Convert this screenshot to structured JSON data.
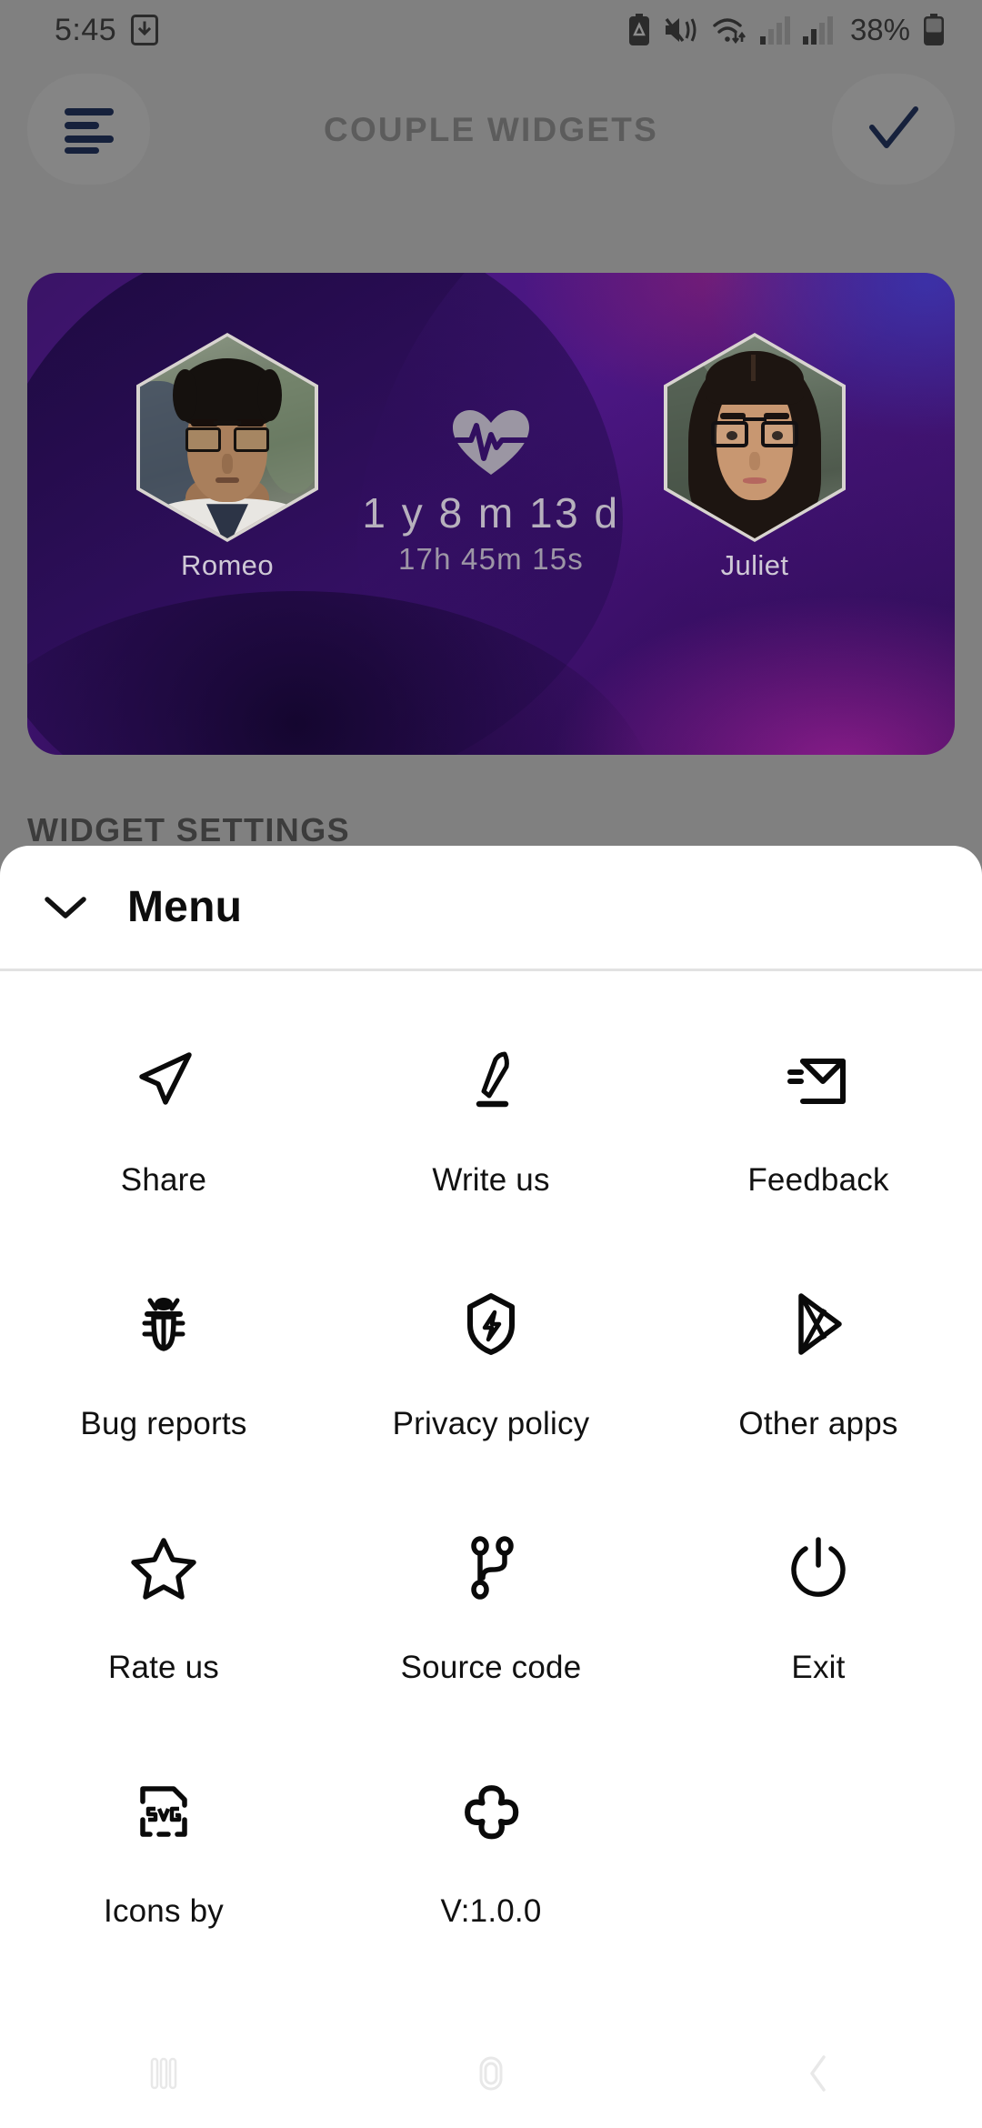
{
  "status_bar": {
    "clock": "5:45",
    "battery_percent": "38%",
    "icons": [
      "download-icon",
      "battery-saver-icon",
      "mute-vibrate-icon",
      "wifi-icon",
      "signal-sim1-icon",
      "signal-sim2-icon",
      "battery-icon"
    ]
  },
  "app_bar": {
    "title": "COUPLE WIDGETS",
    "menu_icon": "hamburger-icon",
    "confirm_icon": "check-icon"
  },
  "widget_card": {
    "left_person": {
      "name": "Romeo"
    },
    "right_person": {
      "name": "Juliet"
    },
    "center_icon": "heart-pulse-icon",
    "duration_main": "1 y 8 m 13 d",
    "duration_sub": "17h 45m 15s",
    "colors": {
      "purple_dark": "#2a0b4e",
      "purple_mid": "#4a1580",
      "magenta": "#d62ab4",
      "blue": "#2c38aa"
    }
  },
  "section_heading": "WIDGET SETTINGS",
  "menu_sheet": {
    "title": "Menu",
    "collapse_icon": "chevron-down-icon",
    "items": [
      {
        "label": "Share",
        "icon": "send-icon"
      },
      {
        "label": "Write us",
        "icon": "pencil-icon"
      },
      {
        "label": "Feedback",
        "icon": "mail-send-icon"
      },
      {
        "label": "Bug reports",
        "icon": "bug-icon"
      },
      {
        "label": "Privacy policy",
        "icon": "shield-bolt-icon"
      },
      {
        "label": "Other apps",
        "icon": "play-store-icon"
      },
      {
        "label": "Rate us",
        "icon": "star-icon"
      },
      {
        "label": "Source code",
        "icon": "git-branch-icon"
      },
      {
        "label": "Exit",
        "icon": "power-icon"
      },
      {
        "label": "Icons by",
        "icon": "svg-file-icon"
      },
      {
        "label": "V:1.0.0",
        "icon": "puzzle-piece-icon"
      }
    ]
  },
  "nav_bar": {
    "recents_icon": "recents-icon",
    "home_icon": "home-icon",
    "back_icon": "back-icon"
  }
}
